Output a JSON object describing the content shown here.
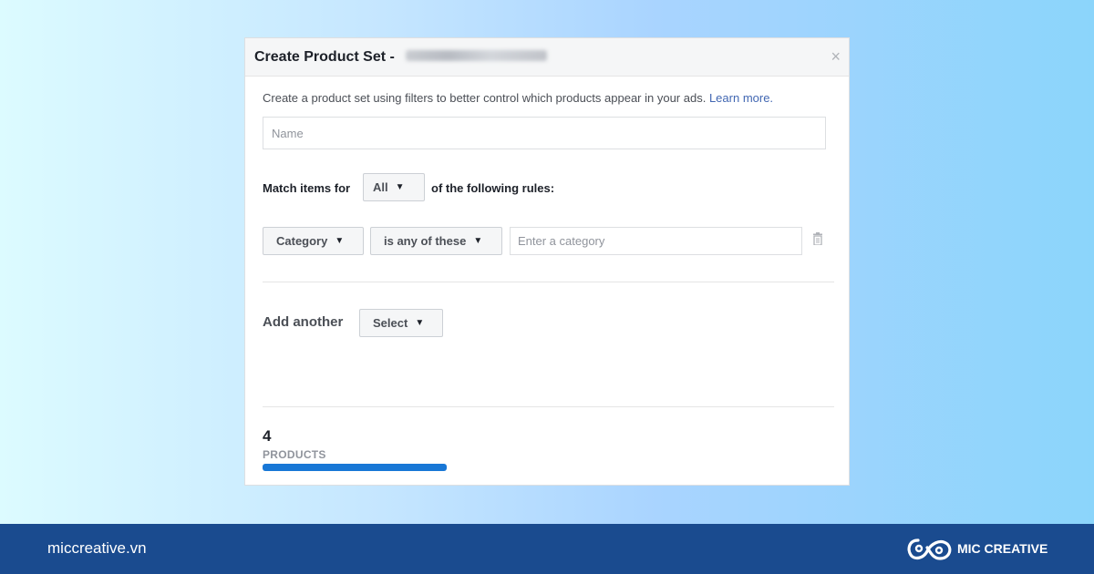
{
  "dialog": {
    "title": "Create Product Set -",
    "close_label": "×",
    "intro_text": "Create a product set using filters to better control which products appear in your ads.",
    "learn_more": "Learn more.",
    "name_placeholder": "Name",
    "match_prefix": "Match items for",
    "match_value": "All",
    "match_suffix": "of the following rules:",
    "rule": {
      "field": "Category",
      "operator": "is any of these",
      "value_placeholder": "Enter a category"
    },
    "add_another_label": "Add another",
    "add_select_label": "Select",
    "product_count": "4",
    "product_count_label": "PRODUCTS",
    "progress_fraction": 1.0,
    "accent_color": "#1877d6"
  },
  "footer": {
    "site": "miccreative.vn",
    "brand": "MIC CREATIVE",
    "background_color": "#1a4b8f"
  },
  "icons": {
    "close": "close-icon",
    "caret": "caret-down-icon",
    "trash": "trash-icon",
    "logo": "mic-creative-logo-icon"
  }
}
